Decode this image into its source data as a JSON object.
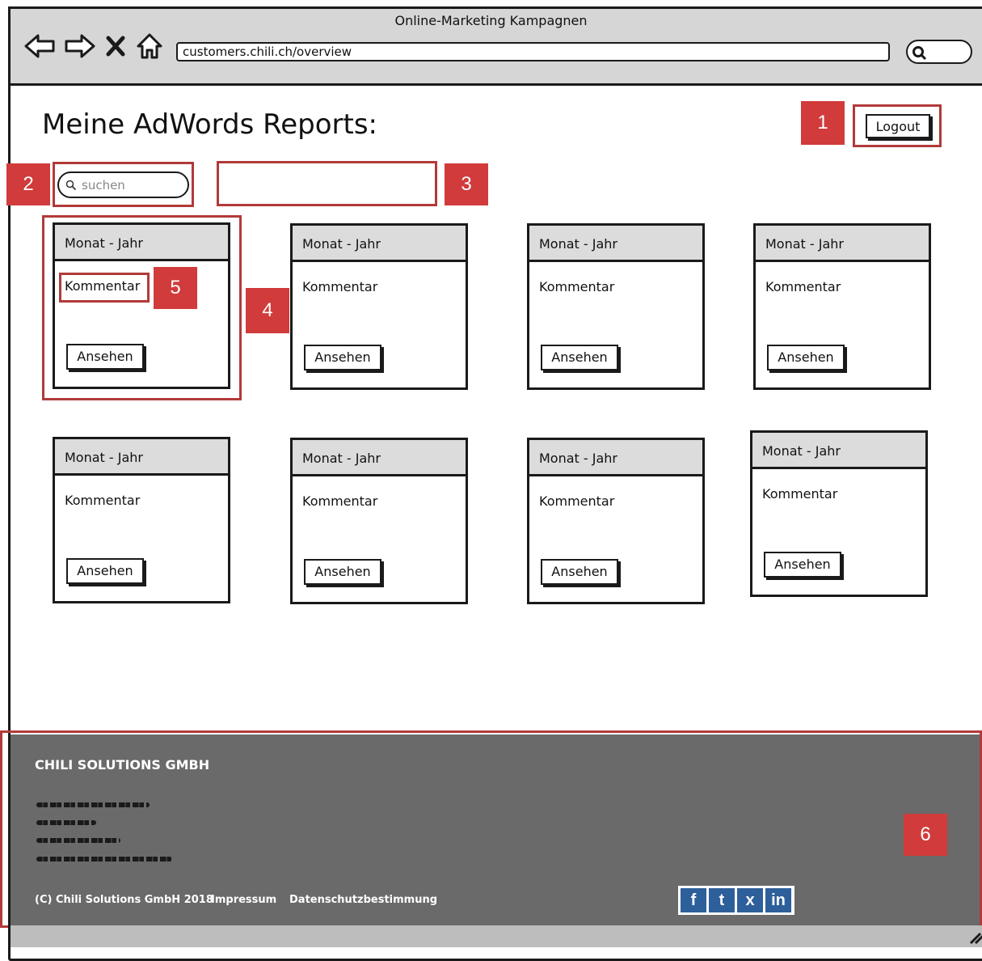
{
  "browser": {
    "window_title": "Online-Marketing Kampagnen",
    "url": "customers.chili.ch/overview",
    "icons": [
      "back-arrow-icon",
      "forward-arrow-icon",
      "close-icon",
      "home-icon",
      "search-icon"
    ]
  },
  "page": {
    "title": "Meine AdWords Reports:",
    "logout_label": "Logout",
    "search_placeholder": "suchen"
  },
  "annotations": [
    "1",
    "2",
    "3",
    "4",
    "5",
    "6"
  ],
  "reports": [
    {
      "header": "Monat - Jahr",
      "comment": "Kommentar",
      "button": "Ansehen"
    },
    {
      "header": "Monat - Jahr",
      "comment": "Kommentar",
      "button": "Ansehen"
    },
    {
      "header": "Monat - Jahr",
      "comment": "Kommentar",
      "button": "Ansehen"
    },
    {
      "header": "Monat - Jahr",
      "comment": "Kommentar",
      "button": "Ansehen"
    },
    {
      "header": "Monat - Jahr",
      "comment": "Kommentar",
      "button": "Ansehen"
    },
    {
      "header": "Monat - Jahr",
      "comment": "Kommentar",
      "button": "Ansehen"
    },
    {
      "header": "Monat - Jahr",
      "comment": "Kommentar",
      "button": "Ansehen"
    },
    {
      "header": "Monat - Jahr",
      "comment": "Kommentar",
      "button": "Ansehen"
    }
  ],
  "footer": {
    "company": "CHILI SOLUTIONS GMBH",
    "copyright": "(C) Chili Solutions GmbH 2018",
    "impressum": "Impressum",
    "privacy": "Datenschutzbestimmung",
    "social": [
      "f",
      "t",
      "x",
      "in"
    ],
    "social_color": "#2d5f9a"
  },
  "colors": {
    "annotation_red": "#d13b3b",
    "footer_bg": "#6a6a6a",
    "chrome_bg": "#d6d6d6"
  }
}
